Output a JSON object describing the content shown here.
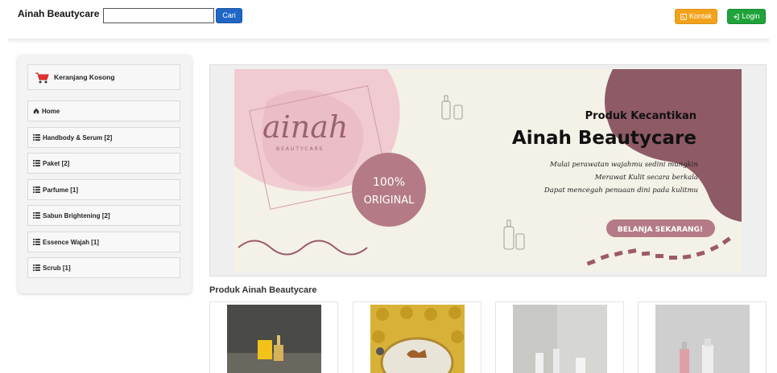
{
  "nav": {
    "brand": "Ainah Beautycare",
    "search_value": "",
    "search_button": "Cari",
    "kontak_button": "Kontak",
    "login_button": "Login"
  },
  "sidebar": {
    "cart_label": "Keranjang Kosong",
    "items": [
      {
        "label": "Home",
        "icon": "home-icon"
      },
      {
        "label": "Handbody & Serum [2]",
        "icon": "list-icon"
      },
      {
        "label": "Paket [2]",
        "icon": "list-icon"
      },
      {
        "label": "Parfume [1]",
        "icon": "list-icon"
      },
      {
        "label": "Sabun Brightening [2]",
        "icon": "list-icon"
      },
      {
        "label": "Essence Wajah [1]",
        "icon": "list-icon"
      },
      {
        "label": "Scrub [1]",
        "icon": "list-icon"
      }
    ]
  },
  "banner": {
    "logo_script": "ainah",
    "logo_sub": "BEAUTYCARE",
    "badge_top": "100%",
    "badge_bottom": "ORIGINAL",
    "heading_small": "Produk Kecantikan",
    "heading_big": "Ainah Beautycare",
    "line1": "Mulai perawatan wajahmu sedini mungkin",
    "line2": "Merawat Kulit secara berkala",
    "line3": "Dapat mencegah penuaan dini pada kulitmu",
    "cta": "BELANJA SEKARANG!"
  },
  "products_title": "Produk Ainah Beautycare",
  "colors": {
    "search_btn": "#1f66c5",
    "kontak_btn": "#f3a21c",
    "login_btn": "#1fa33a",
    "banner_bg": "#f4f1e6",
    "banner_mauve": "#8e5a66",
    "banner_pink": "#e8b7c2"
  }
}
